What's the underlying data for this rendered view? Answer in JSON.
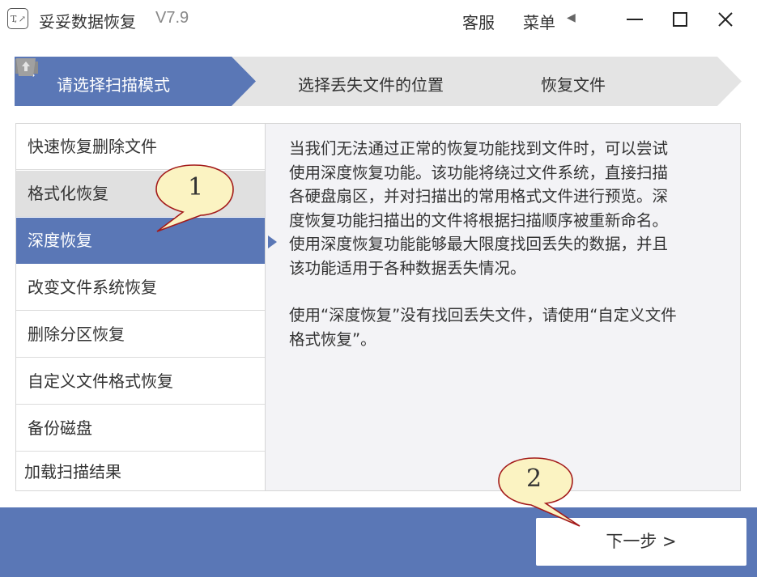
{
  "app": {
    "logo_text": "T, ↗",
    "title": "妥妥数据恢复",
    "version": "V7.9"
  },
  "titlebar": {
    "support_label": "客服",
    "menu_label": "菜单",
    "menu_arrow": "◀"
  },
  "steps": [
    {
      "label": "请选择扫描模式",
      "icon": "search-icon",
      "state": "active"
    },
    {
      "label": "选择丢失文件的位置",
      "icon": "folder-icon",
      "state": "inactive"
    },
    {
      "label": "恢复文件",
      "icon": "restore-icon",
      "state": "inactive"
    }
  ],
  "modes": [
    {
      "label": "快速恢复删除文件",
      "state": "normal"
    },
    {
      "label": "格式化恢复",
      "state": "hover"
    },
    {
      "label": "深度恢复",
      "state": "selected"
    },
    {
      "label": "改变文件系统恢复",
      "state": "normal"
    },
    {
      "label": "删除分区恢复",
      "state": "normal"
    },
    {
      "label": "自定义文件格式恢复",
      "state": "normal"
    },
    {
      "label": "备份磁盘",
      "state": "normal"
    },
    {
      "label": "加载扫描结果",
      "state": "normal"
    }
  ],
  "description": {
    "lines_p1": [
      "当我们无法通过正常的恢复功能找到文件时，可以尝试",
      "使用深度恢复功能。该功能将绕过文件系统，直接扫描",
      "各硬盘扇区，并对扫描出的常用格式文件进行预览。深",
      "度恢复功能扫描出的文件将根据扫描顺序被重新命名。",
      "使用深度恢复功能能够最大限度找回丢失的数据，并且",
      "该功能适用于各种数据丢失情况。"
    ],
    "lines_p2": [
      "使用“深度恢复”没有找回丢失文件，请使用“自定义文件",
      "格式恢复”。"
    ]
  },
  "footer": {
    "next_label": "下一步 >"
  },
  "callouts": {
    "first": "1",
    "second": "2"
  },
  "colors": {
    "accent": "#5a77b6",
    "step_inactive": "#e4e4e4",
    "hover": "#e0e0e0",
    "callout_fill": "#fbf3c2"
  }
}
